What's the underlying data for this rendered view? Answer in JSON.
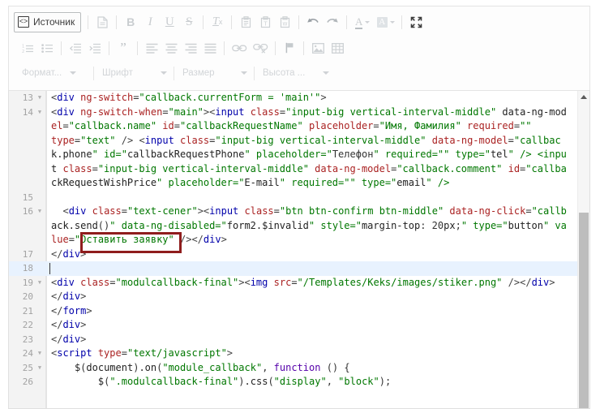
{
  "toolbar": {
    "source_button": {
      "label": "Источник",
      "icon": "source-code-icon",
      "active": true
    },
    "row1": [
      {
        "name": "new-page-icon",
        "title": "Новая страница"
      },
      {
        "name": "bold-icon",
        "glyph": "B"
      },
      {
        "name": "italic-icon",
        "glyph": "I"
      },
      {
        "name": "underline-icon",
        "glyph": "U"
      },
      {
        "name": "strikethrough-icon",
        "glyph": "S"
      },
      {
        "name": "remove-format-icon",
        "glyph": "Tx"
      },
      {
        "name": "paste-icon"
      },
      {
        "name": "paste-as-text-icon"
      },
      {
        "name": "paste-from-word-icon"
      },
      {
        "name": "undo-icon"
      },
      {
        "name": "redo-icon"
      },
      {
        "name": "text-color-icon",
        "glyph": "A"
      },
      {
        "name": "background-color-icon",
        "glyph": "A"
      },
      {
        "name": "maximize-icon"
      }
    ],
    "row2": [
      {
        "name": "numbered-list-icon"
      },
      {
        "name": "bulleted-list-icon"
      },
      {
        "name": "decrease-indent-icon"
      },
      {
        "name": "increase-indent-icon"
      },
      {
        "name": "blockquote-icon"
      },
      {
        "name": "align-left-icon"
      },
      {
        "name": "align-center-icon"
      },
      {
        "name": "align-right-icon"
      },
      {
        "name": "align-justify-icon"
      },
      {
        "name": "link-icon"
      },
      {
        "name": "unlink-icon"
      },
      {
        "name": "anchor-icon"
      },
      {
        "name": "image-icon"
      },
      {
        "name": "table-icon"
      }
    ],
    "combos": [
      {
        "name": "format-select",
        "label": "Формат..."
      },
      {
        "name": "font-select",
        "label": "Шрифт"
      },
      {
        "name": "size-select",
        "label": "Размер"
      },
      {
        "name": "line-height-select",
        "label": "Высота ..."
      }
    ]
  },
  "editor": {
    "active_line": 18,
    "scrollbar": {
      "name": "vertical-scrollbar",
      "up_arrow": "scroll-up-arrow"
    },
    "annotation": {
      "name": "highlight-box",
      "color": "#8f1d1d",
      "target_text": "Оставить заявку"
    },
    "lines": [
      {
        "n": "13",
        "fold": true,
        "text": "<div ng-switch=\"callback.currentForm = 'main'\">"
      },
      {
        "n": "14",
        "fold": true,
        "text": "<div ng-switch-when=\"main\"><input class=\"input-big vertical-interval-middle\" data-ng-mod"
      },
      {
        "n": "",
        "fold": false,
        "text": "el=\"callback.name\" id=\"callbackRequestName\" placeholder=\"Имя, Фамилия\" required=\"\""
      },
      {
        "n": "",
        "fold": false,
        "text": "type=\"text\" /> <input class=\"input-big vertical-interval-middle\" data-ng-model=\"callbac"
      },
      {
        "n": "",
        "fold": false,
        "text": "k.phone\" id=\"callbackRequestPhone\" placeholder=\"Телефон\" required=\"\" type=\"tel\" /> <inpu"
      },
      {
        "n": "",
        "fold": false,
        "text": "t class=\"input-big vertical-interval-middle\" data-ng-model=\"callback.comment\" id=\"callba"
      },
      {
        "n": "",
        "fold": false,
        "text": "ckRequestWishPrice\" placeholder=\"E-mail\" required=\"\" type=\"email\" />"
      },
      {
        "n": "15",
        "fold": false,
        "text": ""
      },
      {
        "n": "16",
        "fold": true,
        "text": "  <div class=\"text-cener\"><input class=\"btn btn-confirm btn-middle\" data-ng-click=\"callb"
      },
      {
        "n": "",
        "fold": false,
        "text": "ack.send()\" data-ng-disabled=\"form2.$invalid\" style=\"margin-top: 20px;\" type=\"button\" va"
      },
      {
        "n": "",
        "fold": false,
        "text": "lue=\"Оставить заявку\" /></div>"
      },
      {
        "n": "17",
        "fold": false,
        "text": "</div>"
      },
      {
        "n": "18",
        "fold": false,
        "text": ""
      },
      {
        "n": "19",
        "fold": true,
        "text": "<div class=\"modulcallback-final\"><img src=\"/Templates/Keks/images/stiker.png\" /></div>"
      },
      {
        "n": "20",
        "fold": false,
        "text": "</div>"
      },
      {
        "n": "21",
        "fold": false,
        "text": "</form>"
      },
      {
        "n": "22",
        "fold": false,
        "text": "</div>"
      },
      {
        "n": "23",
        "fold": false,
        "text": "</div>"
      },
      {
        "n": "24",
        "fold": true,
        "text": "<script type=\"text/javascript\">"
      },
      {
        "n": "25",
        "fold": true,
        "text": "    $(document).on(\"module_callback\", function () {"
      },
      {
        "n": "26",
        "fold": false,
        "text": "        $(\".modulcallback-final\").css(\"display\", \"block\");"
      }
    ]
  }
}
